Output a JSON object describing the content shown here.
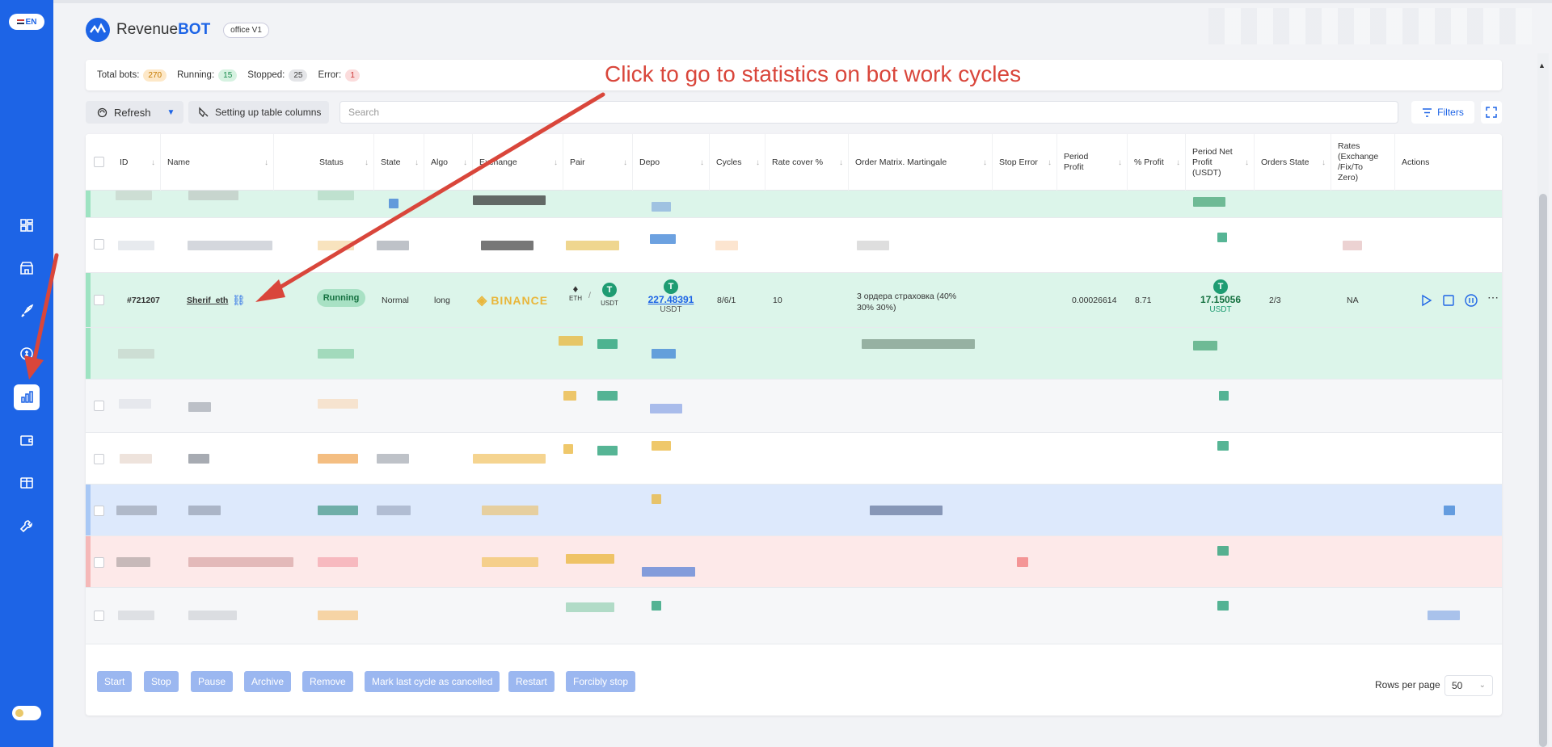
{
  "language": "EN",
  "brand": {
    "name_part1": "Revenue",
    "name_part2": "BOT",
    "office": "office V1"
  },
  "stats": {
    "total_label": "Total bots:",
    "total": "270",
    "running_label": "Running:",
    "running": "15",
    "stopped_label": "Stopped:",
    "stopped": "25",
    "error_label": "Error:",
    "error": "1"
  },
  "annotation": "Click to go to statistics on bot work cycles",
  "toolbar": {
    "refresh": "Refresh",
    "columns": "Setting up table columns",
    "search_placeholder": "Search",
    "filters": "Filters"
  },
  "columns": [
    "ID",
    "Name",
    "Status",
    "State",
    "Algo",
    "Exchange",
    "Pair",
    "Depo",
    "Cycles",
    "Rate cover %",
    "Order Matrix. Martingale",
    "Stop Error",
    "Period Profit",
    "% Profit",
    "Period Net Profit (USDT)",
    "Orders State",
    "Rates (Exchange /Fix/To Zero)",
    "Actions"
  ],
  "featured_row": {
    "id": "#721207",
    "name": "Sherif_eth",
    "status": "Running",
    "state": "Normal",
    "algo": "long",
    "exchange": "BINANCE",
    "pair_base": "ETH",
    "pair_sep": "/",
    "pair_quote": "USDT",
    "depo": "227.48391",
    "depo_unit": "USDT",
    "cycles": "8/6/1",
    "rate_cover": "10",
    "order_matrix": "3 ордера страховка (40% 30% 30%)",
    "period_profit": "0.00026614",
    "percent_profit": "8.71",
    "net_profit": "17.15056",
    "net_unit": "USDT",
    "orders_state": "2/3",
    "rates": "NA"
  },
  "bulk_actions": [
    "Start",
    "Stop",
    "Pause",
    "Archive",
    "Remove",
    "Mark last cycle as cancelled",
    "Restart",
    "Forcibly stop"
  ],
  "pagination": {
    "label": "Rows per page",
    "value": "50"
  },
  "colors": {
    "primary": "#1d64e6",
    "annotation": "#d9463b",
    "running_bg": "#dcf5ea",
    "tether": "#1e9c72"
  },
  "icons": [
    "dashboard-icon",
    "store-icon",
    "rocket-icon",
    "coin-icon",
    "statistics-icon",
    "wallet-icon",
    "layout-icon",
    "wrench-icon"
  ]
}
